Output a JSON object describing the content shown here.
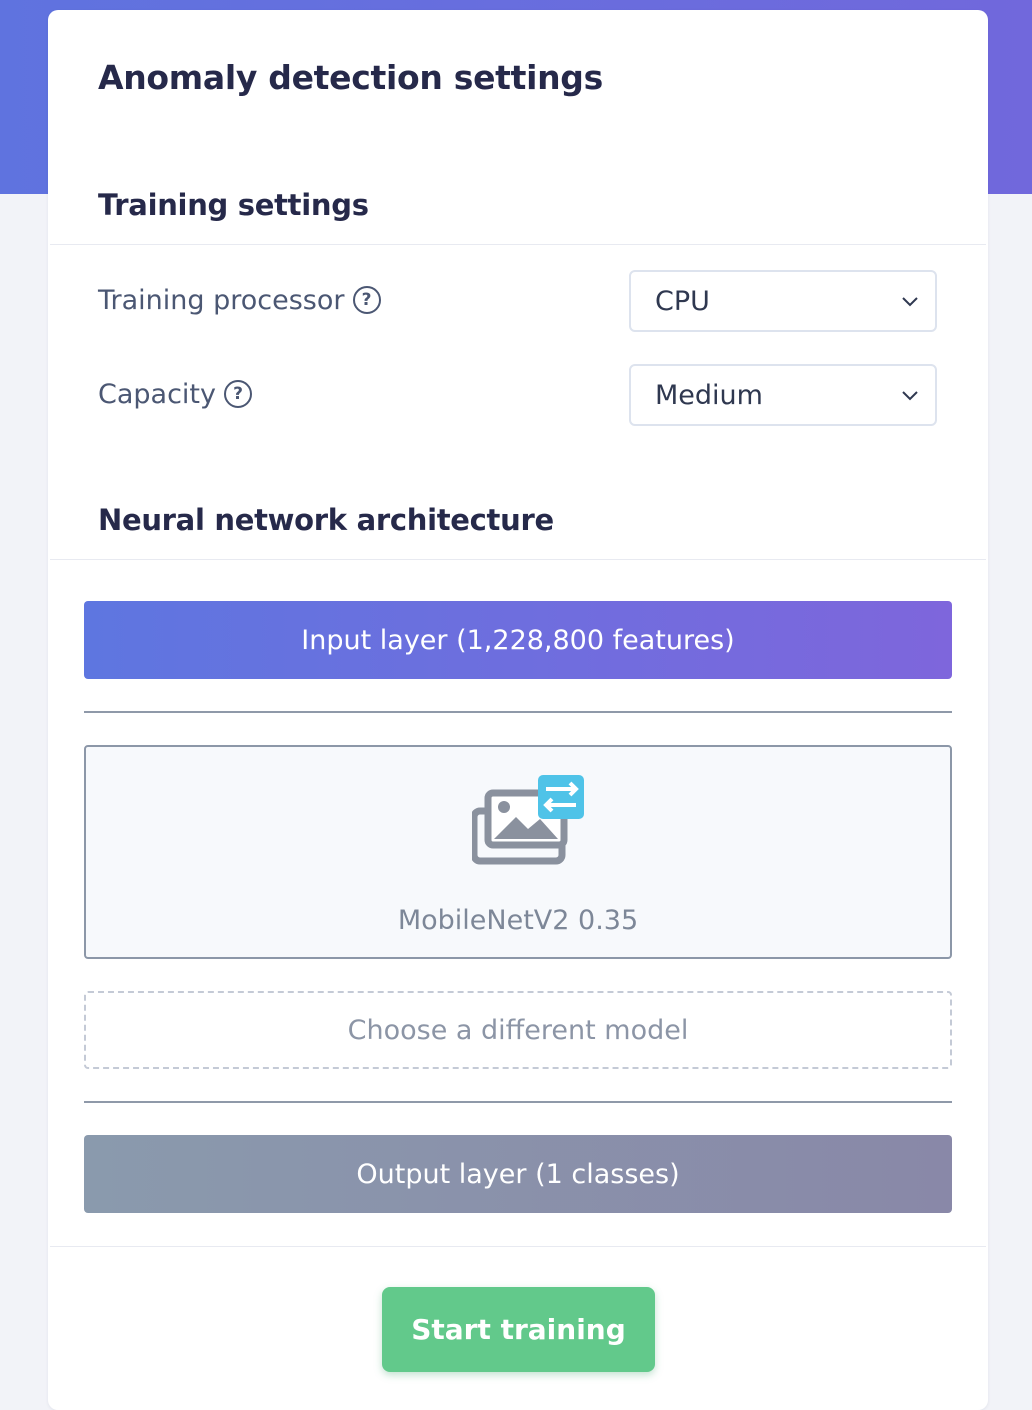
{
  "page": {
    "title": "Anomaly detection settings"
  },
  "training_settings": {
    "heading": "Training settings",
    "processor": {
      "label": "Training processor",
      "value": "CPU",
      "help_icon": "question-circle-icon"
    },
    "capacity": {
      "label": "Capacity",
      "value": "Medium",
      "help_icon": "question-circle-icon"
    }
  },
  "architecture": {
    "heading": "Neural network architecture",
    "input_layer": "Input layer (1,228,800 features)",
    "model": {
      "name": "MobileNetV2 0.35",
      "icon": "transfer-learning-images-icon"
    },
    "choose_model": "Choose a different model",
    "output_layer": "Output layer (1 classes)"
  },
  "actions": {
    "start_training": "Start training"
  },
  "colors": {
    "hero": "#6b6ddd",
    "input_layer": "#6a6fde",
    "output_layer": "#8a92aa",
    "start_button": "#62c98b",
    "icon_accent": "#4fc3e8"
  }
}
